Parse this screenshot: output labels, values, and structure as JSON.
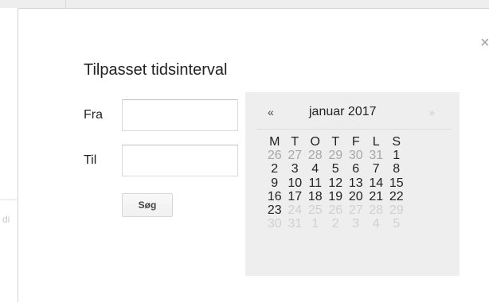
{
  "background": {
    "left_fragment": "di"
  },
  "dialog": {
    "title": "Tilpasset tidsinterval",
    "close_glyph": "×",
    "from_label": "Fra",
    "to_label": "Til",
    "from_value": "",
    "to_value": "",
    "search_label": "Søg"
  },
  "calendar": {
    "prev_glyph": "«",
    "next_glyph": "»",
    "month_label": "januar 2017",
    "weekdays": [
      "M",
      "T",
      "O",
      "T",
      "F",
      "L",
      "S"
    ],
    "weeks": [
      [
        {
          "d": "26",
          "s": "outside"
        },
        {
          "d": "27",
          "s": "outside"
        },
        {
          "d": "28",
          "s": "outside"
        },
        {
          "d": "29",
          "s": "outside"
        },
        {
          "d": "30",
          "s": "outside"
        },
        {
          "d": "31",
          "s": "outside"
        },
        {
          "d": "1",
          "s": "current"
        }
      ],
      [
        {
          "d": "2",
          "s": "current"
        },
        {
          "d": "3",
          "s": "current"
        },
        {
          "d": "4",
          "s": "current"
        },
        {
          "d": "5",
          "s": "current"
        },
        {
          "d": "6",
          "s": "current"
        },
        {
          "d": "7",
          "s": "current"
        },
        {
          "d": "8",
          "s": "current"
        }
      ],
      [
        {
          "d": "9",
          "s": "current"
        },
        {
          "d": "10",
          "s": "current"
        },
        {
          "d": "11",
          "s": "current"
        },
        {
          "d": "12",
          "s": "current"
        },
        {
          "d": "13",
          "s": "current"
        },
        {
          "d": "14",
          "s": "current"
        },
        {
          "d": "15",
          "s": "current"
        }
      ],
      [
        {
          "d": "16",
          "s": "current"
        },
        {
          "d": "17",
          "s": "current"
        },
        {
          "d": "18",
          "s": "current"
        },
        {
          "d": "19",
          "s": "current"
        },
        {
          "d": "20",
          "s": "current"
        },
        {
          "d": "21",
          "s": "current"
        },
        {
          "d": "22",
          "s": "current"
        }
      ],
      [
        {
          "d": "23",
          "s": "current"
        },
        {
          "d": "24",
          "s": "future"
        },
        {
          "d": "25",
          "s": "future"
        },
        {
          "d": "26",
          "s": "future"
        },
        {
          "d": "27",
          "s": "future"
        },
        {
          "d": "28",
          "s": "future"
        },
        {
          "d": "29",
          "s": "future"
        }
      ],
      [
        {
          "d": "30",
          "s": "future"
        },
        {
          "d": "31",
          "s": "future"
        },
        {
          "d": "1",
          "s": "future"
        },
        {
          "d": "2",
          "s": "future"
        },
        {
          "d": "3",
          "s": "future"
        },
        {
          "d": "4",
          "s": "future"
        },
        {
          "d": "5",
          "s": "future"
        }
      ]
    ]
  },
  "colors": {
    "calendar_background": "#eeeeee",
    "text": "#222222",
    "outside_month_day": "#a8a8a8",
    "future_day": "#d0d0d0"
  }
}
